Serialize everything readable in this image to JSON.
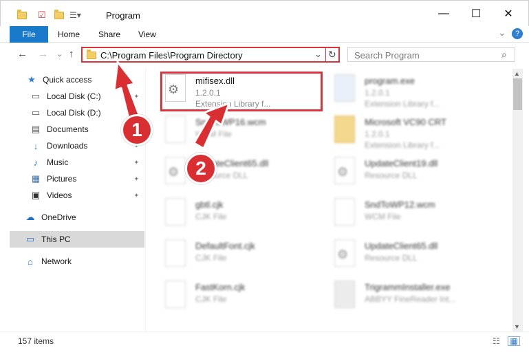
{
  "window": {
    "title": "Program",
    "minimize": "—",
    "maximize": "☐",
    "close": "✕"
  },
  "ribbon": {
    "file": "File",
    "tabs": [
      "Home",
      "Share",
      "View"
    ],
    "expand": "⌄",
    "help": "?"
  },
  "nav": {
    "back": "←",
    "forward": "→",
    "recent": "⌄",
    "up": "↑",
    "address": "C:\\Program Files\\Program Directory",
    "dropdown": "⌄",
    "refresh": "↻",
    "search_placeholder": "Search Program",
    "search_icon": "⌕"
  },
  "sidebar": {
    "items": [
      {
        "label": "Quick access",
        "icon": "star-icon",
        "glyph": "★",
        "pinned": false
      },
      {
        "label": "Local Disk (C:)",
        "icon": "drive-icon",
        "glyph": "▭",
        "pinned": true
      },
      {
        "label": "Local Disk (D:)",
        "icon": "drive-icon",
        "glyph": "▭",
        "pinned": true
      },
      {
        "label": "Documents",
        "icon": "documents-icon",
        "glyph": "▤",
        "pinned": true
      },
      {
        "label": "Downloads",
        "icon": "download-icon",
        "glyph": "↓",
        "pinned": true
      },
      {
        "label": "Music",
        "icon": "music-icon",
        "glyph": "♪",
        "pinned": true
      },
      {
        "label": "Pictures",
        "icon": "pictures-icon",
        "glyph": "▦",
        "pinned": true
      },
      {
        "label": "Videos",
        "icon": "video-icon",
        "glyph": "▣",
        "pinned": true
      },
      {
        "label": "OneDrive",
        "icon": "cloud-icon",
        "glyph": "☁",
        "pinned": false
      },
      {
        "label": "This PC",
        "icon": "computer-icon",
        "glyph": "▭",
        "pinned": false
      },
      {
        "label": "Network",
        "icon": "network-icon",
        "glyph": "⌂",
        "pinned": false
      }
    ],
    "pin_glyph": "📌"
  },
  "files": {
    "left": [
      {
        "name": "mifisex.dll",
        "meta1": "1.2.0.1",
        "meta2": "Extension Library f..."
      },
      {
        "name": "SndToWP16.wcm",
        "meta1": "WCM File",
        "meta2": ""
      },
      {
        "name": "UpdateClient65.dll",
        "meta1": "Resource DLL",
        "meta2": ""
      },
      {
        "name": "gbtl.cjk",
        "meta1": "CJK File",
        "meta2": ""
      },
      {
        "name": "DefaultFont.cjk",
        "meta1": "CJK File",
        "meta2": ""
      },
      {
        "name": "FastKorn.cjk",
        "meta1": "CJK File",
        "meta2": ""
      }
    ],
    "right": [
      {
        "name": "program.exe",
        "meta1": "1.2.0.1",
        "meta2": "Extension Library f..."
      },
      {
        "name": "Microsoft VC90 CRT",
        "meta1": "1.2.0.1",
        "meta2": "Extension Library f..."
      },
      {
        "name": "UpdateClient19.dll",
        "meta1": "Resource DLL",
        "meta2": ""
      },
      {
        "name": "SndToWP12.wcm",
        "meta1": "WCM File",
        "meta2": ""
      },
      {
        "name": "UpdateClient65.dll",
        "meta1": "Resource DLL",
        "meta2": ""
      },
      {
        "name": "TrigrammInstaller.exe",
        "meta1": "ABBYY FineReader Int...",
        "meta2": ""
      }
    ]
  },
  "status": {
    "items": "157 items"
  },
  "callouts": [
    "1",
    "2"
  ]
}
